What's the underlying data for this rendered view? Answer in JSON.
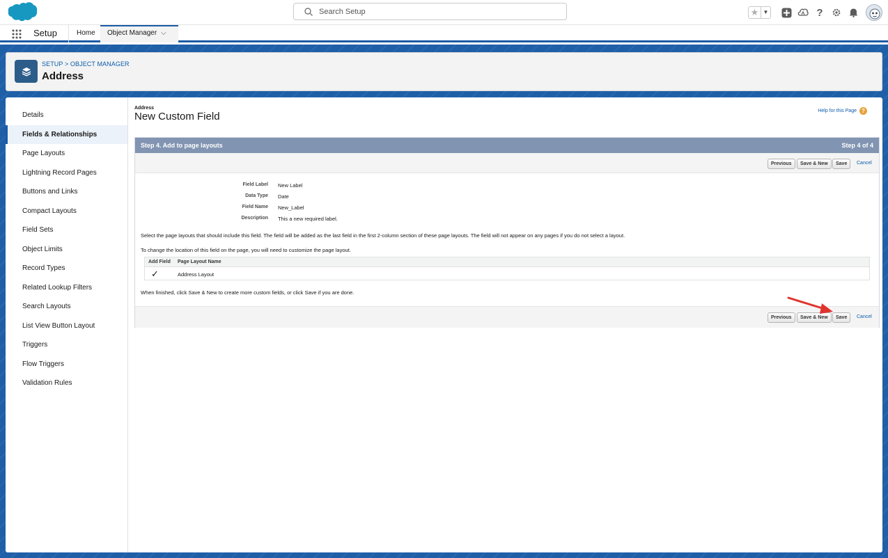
{
  "header": {
    "search_placeholder": "Search Setup",
    "icons": [
      "favorites-star-icon",
      "favorites-dropdown-icon",
      "global-actions-icon",
      "trailhead-icon",
      "help-icon",
      "setup-gear-icon",
      "notifications-bell-icon",
      "user-avatar"
    ]
  },
  "nav": {
    "app_name": "Setup",
    "home_label": "Home",
    "object_manager_label": "Object Manager"
  },
  "page_header": {
    "breadcrumb": "SETUP > OBJECT MANAGER",
    "title": "Address"
  },
  "sidebar": {
    "items": [
      {
        "label": "Details"
      },
      {
        "label": "Fields & Relationships"
      },
      {
        "label": "Page Layouts"
      },
      {
        "label": "Lightning Record Pages"
      },
      {
        "label": "Buttons and Links"
      },
      {
        "label": "Compact Layouts"
      },
      {
        "label": "Field Sets"
      },
      {
        "label": "Object Limits"
      },
      {
        "label": "Record Types"
      },
      {
        "label": "Related Lookup Filters"
      },
      {
        "label": "Search Layouts"
      },
      {
        "label": "List View Button Layout"
      },
      {
        "label": "Triggers"
      },
      {
        "label": "Flow Triggers"
      },
      {
        "label": "Validation Rules"
      }
    ],
    "active_label": "Fields & Relationships"
  },
  "content": {
    "pre_title": "Address",
    "title": "New Custom Field",
    "help_link": "Help for this Page",
    "step_title": "Step 4. Add to page layouts",
    "step_count": "Step 4 of 4",
    "buttons": {
      "previous": "Previous",
      "save_new": "Save & New",
      "save": "Save",
      "cancel": "Cancel"
    },
    "details": {
      "field_label_label": "Field Label",
      "field_label_value": "New Label",
      "data_type_label": "Data Type",
      "data_type_value": "Date",
      "field_name_label": "Field Name",
      "field_name_value": "New_Label",
      "description_label": "Description",
      "description_value": "This a new required label."
    },
    "instruction_1": "Select the page layouts that should include this field. The field will be added as the last field in the first 2-column section of these page layouts. The field will not appear on any pages if you do not select a layout.",
    "instruction_2": "To change the location of this field on the page, you will need to customize the page layout.",
    "table": {
      "headers": [
        "Add Field",
        "Page Layout Name"
      ],
      "rows": [
        {
          "checked_mark": "✓",
          "layout_name": "Address Layout"
        }
      ]
    },
    "finish_text": "When finished, click Save & New to create more custom fields, or click Save if you are done."
  },
  "colors": {
    "brand_blue": "#1b5ba6",
    "step_header": "#8194b2",
    "link": "#0b5cab",
    "annotation_arrow": "#e0332e"
  }
}
